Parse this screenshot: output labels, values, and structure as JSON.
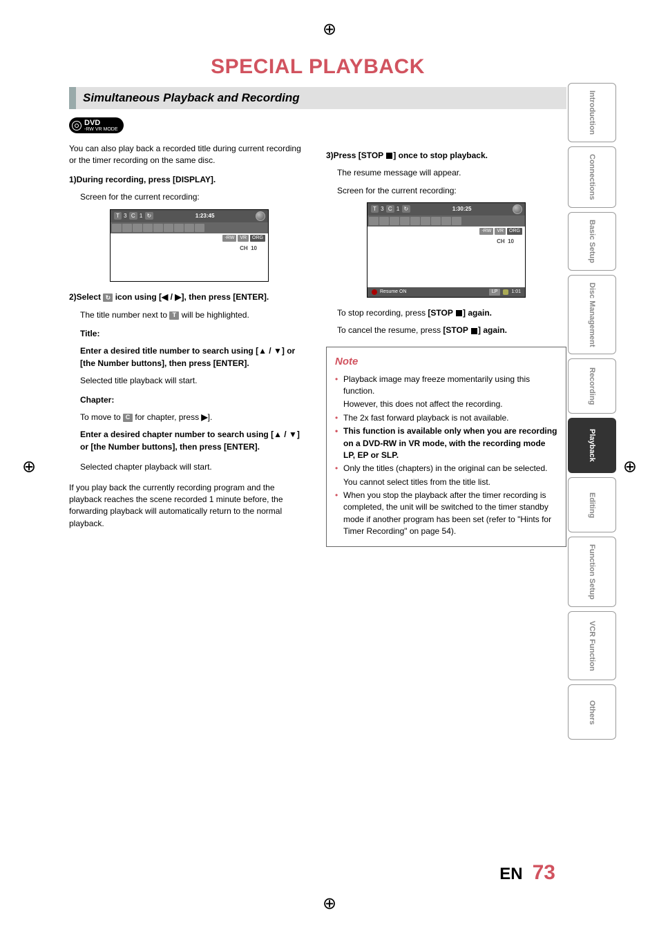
{
  "page_title": "SPECIAL PLAYBACK",
  "section_heading": "Simultaneous Playback and Recording",
  "dvd_badge": {
    "main": "DVD",
    "sub1": "-RW",
    "sub2": "VR MODE"
  },
  "intro": "You can also play back a recorded title during current recording or the timer recording on the same disc.",
  "step1": {
    "num": "1)",
    "text": "During recording, press [DISPLAY]."
  },
  "step1_note": "Screen for the current recording:",
  "osd1": {
    "t": "T",
    "t_val": "3",
    "c": "C",
    "c_val": "1",
    "time": "1:23:45",
    "tags": [
      "-RW",
      "VR",
      "ORG"
    ],
    "ch_label": "CH",
    "ch_val": "10"
  },
  "step2": {
    "num": "2)",
    "pre": "Select ",
    "icon": "↻",
    "mid": " icon using [",
    "arr_l": "◀",
    "sep": " / ",
    "arr_r": "▶",
    "post": "], then press [ENTER]."
  },
  "step2_note_a": "The title number next to ",
  "step2_note_icon": "T",
  "step2_note_b": " will be highlighted.",
  "title_label": "Title:",
  "title_instr_a": "Enter a desired title number to search using [",
  "arr_up": "▲",
  "arr_dn": "▼",
  "title_instr_b": "] or [the Number buttons], then press [ENTER].",
  "title_result": "Selected title playback will start.",
  "chapter_label": "Chapter:",
  "chapter_move_a": "To move to ",
  "chapter_move_icon": "C",
  "chapter_move_b": " for chapter, press ",
  "arr_right": "▶",
  "chapter_move_c": "].",
  "chapter_instr_a": "Enter a desired chapter number to search using [",
  "chapter_instr_b": "] or [the Number buttons], then press [ENTER].",
  "chapter_result": "Selected chapter playback will start.",
  "col1_para": "If you play back the currently recording program and the playback reaches the scene recorded 1 minute before, the forwarding playback will automatically return to the normal playback.",
  "step3": {
    "num": "3)",
    "a": "Press [STOP ",
    "b": "] once to stop playback."
  },
  "step3_note1": "The resume message will appear.",
  "step3_note2": "Screen for the current recording:",
  "osd2": {
    "t": "T",
    "t_val": "3",
    "c": "C",
    "c_val": "1",
    "time": "1:30:25",
    "tags": [
      "-RW",
      "VR",
      "ORG"
    ],
    "ch_label": "CH",
    "ch_val": "10",
    "resume": "Resume ON",
    "mode": "LP",
    "remain": "1:01"
  },
  "stop_rec_a": "To stop recording, press ",
  "stop_rec_btn": "[STOP ",
  "stop_rec_b": "] again.",
  "cancel_a": "To cancel the resume, press ",
  "cancel_b": "] again.",
  "note_head": "Note",
  "notes": [
    "Playback image may freeze momentarily using this function.",
    "However, this does not affect the recording.",
    "The 2x fast forward playback is not available.",
    "This function is available only when you are recording on a DVD-RW in VR mode, with the recording mode LP, EP or SLP.",
    "Only the titles (chapters) in the original can be selected.",
    "You cannot select titles from the title list.",
    "When you stop the playback after the timer recording is completed, the unit will be switched to the timer standby mode if another program has been set (refer to \"Hints for Timer Recording\" on page 54)."
  ],
  "tabs": [
    "Introduction",
    "Connections",
    "Basic Setup",
    "Disc Management",
    "Recording",
    "Playback",
    "Editing",
    "Function Setup",
    "VCR Function",
    "Others"
  ],
  "footer": {
    "lang": "EN",
    "page": "73"
  }
}
